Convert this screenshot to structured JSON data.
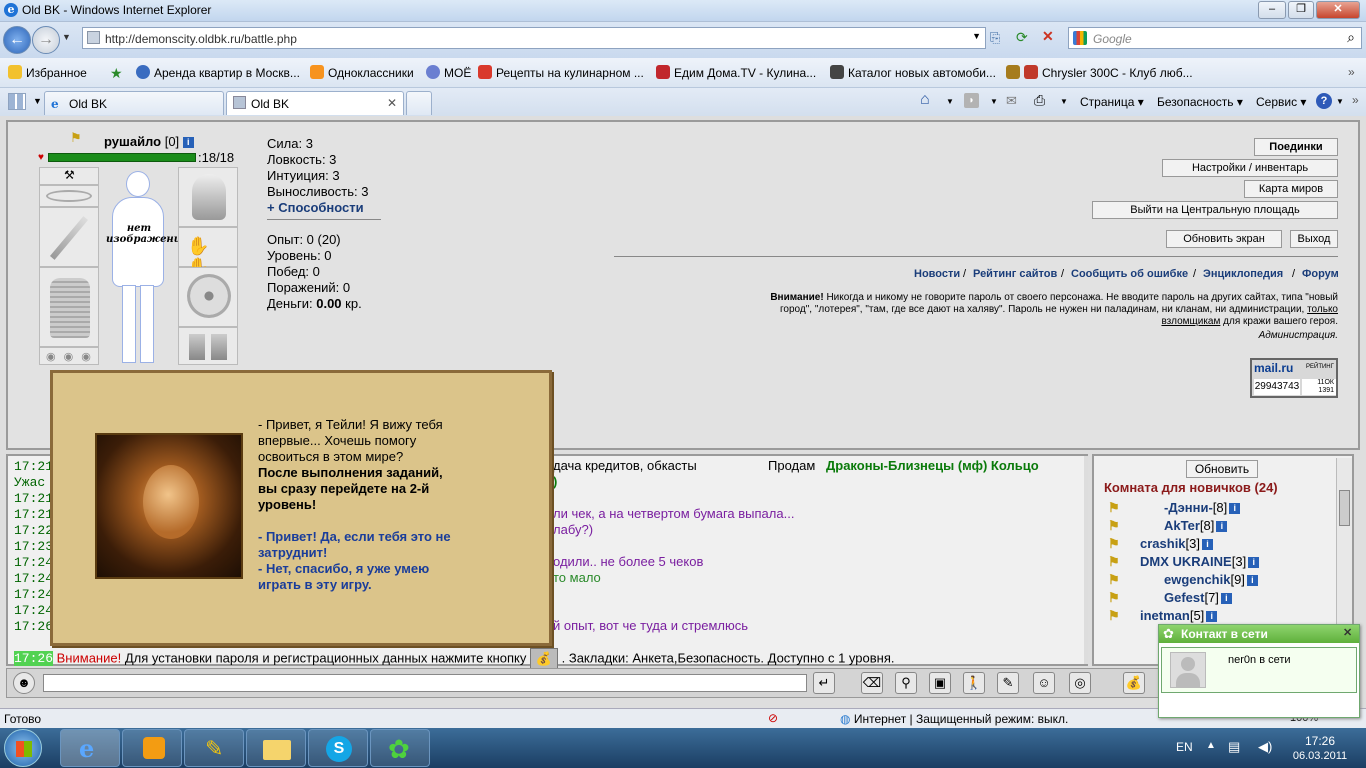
{
  "window": {
    "title": "Old BK - Windows Internet Explorer"
  },
  "address": {
    "url": "http://demonscity.oldbk.ru/battle.php",
    "search_placeholder": "Google"
  },
  "favorites": {
    "label": "Избранное",
    "items": [
      "Аренда квартир в Москв...",
      "Одноклассники",
      "МОЁ",
      "Рецепты на кулинарном ...",
      "Едим Дома.TV - Кулина...",
      "Каталог новых автомоби...",
      "Chrysler 300C - Клуб люб..."
    ]
  },
  "tabs": [
    {
      "label": "Old BK"
    },
    {
      "label": "Old BK"
    }
  ],
  "commands": {
    "page": "Страница",
    "safety": "Безопасность",
    "service": "Сервис"
  },
  "character": {
    "name": "рушайло",
    "level": "[0]",
    "hp": ":18/18",
    "no_image": "нет изображения"
  },
  "stats": {
    "strength": "Сила: 3",
    "agility": "Ловкость: 3",
    "intuition": "Интуиция: 3",
    "endurance": "Выносливость: 3",
    "abilities": "+ Способности",
    "experience": "Опыт: 0 (20)",
    "level": "Уровень: 0",
    "wins": "Побед: 0",
    "losses": "Поражений: 0",
    "money_label": "Деньги:",
    "money_value": "0.00",
    "money_unit": "кр."
  },
  "buttons": {
    "fights": "Поединки",
    "settings": "Настройки / инвентарь",
    "map": "Карта миров",
    "central": "Выйти на Центральную площадь",
    "refresh": "Обновить экран",
    "exit": "Выход",
    "room_refresh": "Обновить"
  },
  "nav": {
    "news": "Новости",
    "rating": "Рейтинг сайтов",
    "report": "Сообщить об ошибке",
    "encyclopedia": "Энциклопедия",
    "forum": "Форум",
    "sep": "/"
  },
  "warning": {
    "label": "Внимание!",
    "text1": "Никогда и никому не говорите пароль от своего персонажа. Не вводите пароль на других сайтах, типа \"новый",
    "text2": "город\", \"лотерея\", \"там, где все дают на халяву\". Пароль не нужен ни паладинам, ни кланам, ни администрации,",
    "only": "только",
    "hackers": "взломщикам",
    "text3": "для кражи вашего героя.",
    "admin": "Администрация."
  },
  "counter": {
    "brand": "mail.ru",
    "label": "РЕЙТИНГ",
    "value": "29943743",
    "small1": "11ОК",
    "small2": "1391"
  },
  "chat": {
    "lines": [
      {
        "time": "17:21",
        "text": "дача кредитов, обкасты",
        "extra": "Продам",
        "green": "Драконы-Близнецы (мф) Кольцо"
      },
      {
        "time": "Ужас",
        "text": "",
        "extra": "",
        "green": ")"
      },
      {
        "time": "17:21",
        "text": "",
        "extra": "",
        "green": ""
      },
      {
        "time": "17:21",
        "text": "ли чек, а на четвертом бумага выпала...",
        "extra": "",
        "green": ""
      },
      {
        "time": "17:22",
        "text": "лабу?)",
        "extra": "",
        "green": ""
      },
      {
        "time": "17:23",
        "text": "",
        "extra": "",
        "green": ""
      },
      {
        "time": "17:24",
        "text": "одили.. не более 5 чеков",
        "extra": "",
        "green": ""
      },
      {
        "time": "17:24",
        "text": "то мало",
        "extra": "",
        "green": ""
      },
      {
        "time": "17:24",
        "text": "",
        "extra": "",
        "green": ""
      },
      {
        "time": "17:24",
        "text": "",
        "extra": "",
        "green": ""
      },
      {
        "time": "17:26",
        "text": "й опыт, вот че туда и стремлюсь",
        "extra": "",
        "green": ""
      }
    ],
    "system_time": "17:26",
    "system_label": "Внимание!",
    "system_text1": "Для установки пароля и регистрационных данных нажмите кнопку",
    "system_text2": ". Закладки: Анкета,Безопасность. Доступно с 1 уровня."
  },
  "room": {
    "title": "Комната для новичков (24)",
    "users": [
      "-Дэнни-",
      "AkTer",
      "crashik",
      "DMX UKRAINE",
      "ewgenchik",
      "Gefest",
      "inetman"
    ],
    "levels": [
      "[8]",
      "[8]",
      "[3]",
      "[3]",
      "[9]",
      "[7]",
      "[5]"
    ]
  },
  "popup": {
    "line1": "- Привет, я Тейли! Я вижу тебя",
    "line2": "впервые... Хочешь помогу",
    "line3": "освоиться в этом мире?",
    "bold1": "После выполнения заданий,",
    "bold2": "вы сразу перейдете на 2-й",
    "bold3": "уровень!",
    "yes1": "- Привет! Да, если тебя это не",
    "yes2": "затруднит!",
    "no1": "- Нет, спасибо, я уже умею",
    "no2": "играть в эту игру."
  },
  "statusbar": {
    "ready": "Готово",
    "zone": "Интернет | Защищенный режим: выкл.",
    "zoom": "100%"
  },
  "notification": {
    "title": "Контакт в сети",
    "text": "ner0n в сети"
  },
  "tray": {
    "lang": "EN",
    "time": "17:26",
    "date": "06.03.2011"
  }
}
